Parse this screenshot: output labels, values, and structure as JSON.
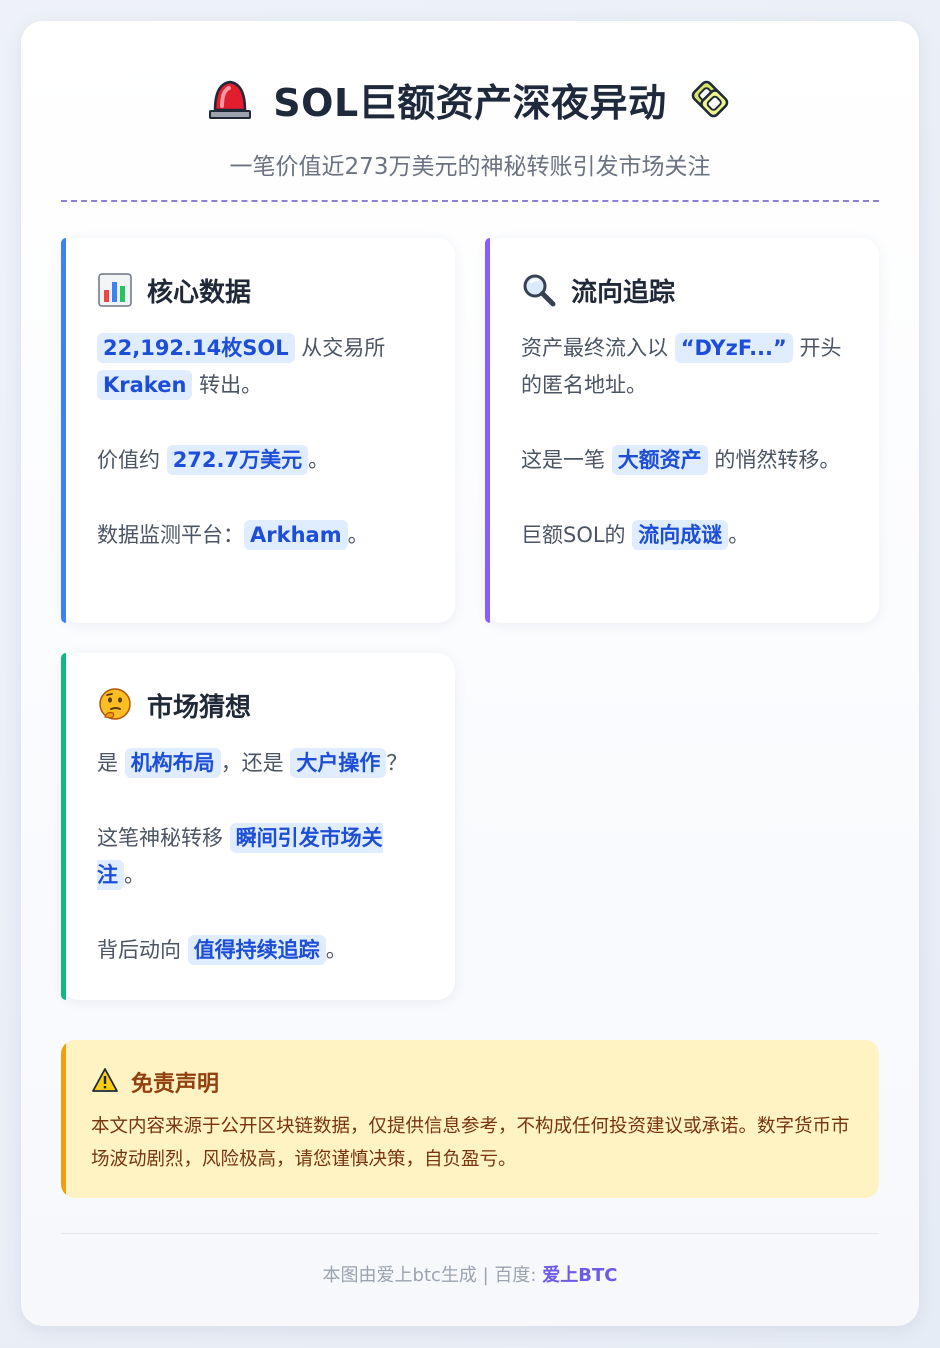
{
  "header": {
    "title": "SOL巨额资产深夜异动",
    "subtitle": "一笔价值近273万美元的神秘转账引发市场关注",
    "left_icon": "siren-icon",
    "right_icon": "chain-icon"
  },
  "cards": {
    "core": {
      "title": "核心数据",
      "icon": "bar-chart-icon",
      "p1_hl1": "22,192.14枚SOL",
      "p1_t1": " 从交易所 ",
      "p1_hl2": "Kraken",
      "p1_t2": " 转出。",
      "p2_t1": "价值约 ",
      "p2_hl1": "272.7万美元",
      "p2_t2": "。",
      "p3_t1": "数据监测平台：",
      "p3_hl1": "Arkham",
      "p3_t2": "。"
    },
    "flow": {
      "title": "流向追踪",
      "icon": "magnifier-icon",
      "p1_t1": "资产最终流入以 ",
      "p1_hl1": "“DYzF...”",
      "p1_t2": " 开头的匿名地址。",
      "p2_t1": "这是一笔 ",
      "p2_hl1": "大额资产",
      "p2_t2": " 的悄然转移。",
      "p3_t1": "巨额SOL的 ",
      "p3_hl1": "流向成谜",
      "p3_t2": "。"
    },
    "market": {
      "title": "市场猜想",
      "icon": "thinking-face-icon",
      "p1_t1": "是 ",
      "p1_hl1": "机构布局",
      "p1_t2": "，还是 ",
      "p1_hl2": "大户操作",
      "p1_t3": "？",
      "p2_t1": "这笔神秘转移 ",
      "p2_hl1": "瞬间引发市场关注",
      "p2_t2": "。",
      "p3_t1": "背后动向 ",
      "p3_hl1": "值得持续追踪",
      "p3_t2": "。"
    }
  },
  "disclaimer": {
    "title": "免责声明",
    "icon": "warning-icon",
    "text": "本文内容来源于公开区块链数据，仅提供信息参考，不构成任何投资建议或承诺。数字货币市场波动剧烈，风险极高，请您谨慎决策，自负盈亏。"
  },
  "footer": {
    "prefix": "本图由爱上btc生成 | 百度: ",
    "brand": "爱上BTC"
  },
  "colors": {
    "blue_accent": "#3b82f6",
    "purple_accent": "#8b5cf6",
    "green_accent": "#10b981",
    "highlight_bg": "#e0ecff",
    "highlight_text": "#1d4ed8",
    "disclaimer_bg": "#fff3c4",
    "disclaimer_accent": "#f59e0b",
    "brand": "#6d5ae6"
  }
}
